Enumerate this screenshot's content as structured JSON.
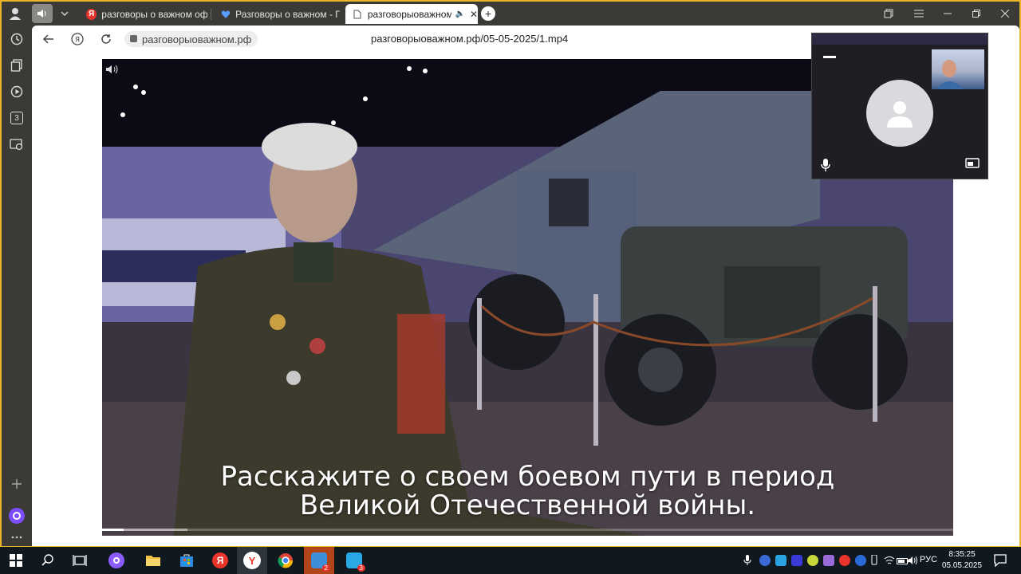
{
  "tabs": [
    {
      "title": "разговоры о важном офи",
      "favicon": "yandex-logo-icon"
    },
    {
      "title": "Разговоры о важном - ГБ",
      "favicon": "heart-icon"
    },
    {
      "title": "разговорыоважном",
      "favicon": "page-icon",
      "active": true
    }
  ],
  "toolbar": {
    "domain": "разговорыоважном.рф",
    "url": "разговорыоважном.рф/05-05-2025/1.mp4"
  },
  "sidebar": {
    "badge_number": "3"
  },
  "video": {
    "subtitle_line1": "Расскажите о своем боевом пути в период",
    "subtitle_line2": "Великой Отечественной войны.",
    "progress": 0.025,
    "buffered": 0.1
  },
  "taskbar": {
    "language": "РУС",
    "time": "8:35:25",
    "date": "05.05.2025",
    "badges": [
      "2",
      "3"
    ]
  },
  "colors": {
    "desktop_border": "#e9b52a",
    "browser_chrome": "#3b3a37",
    "taskbar": "#101820",
    "alice_purple": "#7b4dff",
    "yandex_red": "#e8342a"
  }
}
